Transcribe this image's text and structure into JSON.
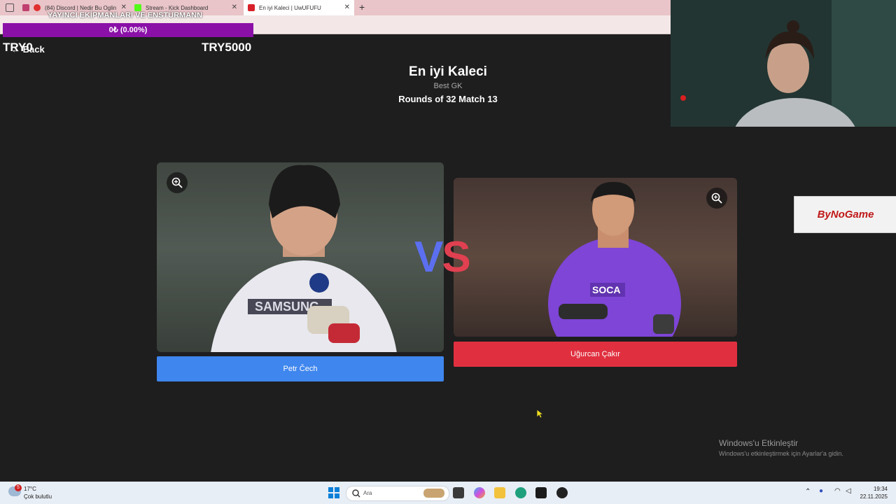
{
  "browser": {
    "tabs": [
      {
        "label": "(84) Discord | Nedir Bu Oglin"
      },
      {
        "label": "Stream - Kick Dashboard"
      },
      {
        "label": "En iyi Kaleci | UwUFUFU"
      }
    ],
    "new_tab": "+"
  },
  "overlay": {
    "donation_title": "YAYINCI EKİPMANLARI VE ENSTÜRMANN",
    "goal_progress": "0₺ (0.00%)",
    "goal_fraction": 0.0,
    "goal_min": "TRY0",
    "goal_max": "TRY5000"
  },
  "page": {
    "back_label": "Back",
    "title": "En iyi Kaleci",
    "subtitle": "Best GK",
    "round": "Rounds of 32 Match 13",
    "vs": "VS",
    "left_choice": "Petr Čech",
    "right_choice": "Uğurcan Çakır"
  },
  "sponsor": {
    "logo": "ByNoGame"
  },
  "watermark": {
    "title": "Windows'u Etkinleştir",
    "subtitle": "Windows'u etkinleştirmek için Ayarlar'a gidin."
  },
  "taskbar": {
    "weather_temp": "17°C",
    "weather_desc": "Çok bulutlu",
    "weather_badge": "5",
    "search_placeholder": "Ara",
    "time": "19:34",
    "date": "22.11.2025"
  },
  "colors": {
    "left_button": "#3f86ee",
    "right_button": "#e0303f",
    "goal_bar": "#8b10a8",
    "vs_left": "#5b6ff0",
    "vs_right": "#e04050"
  }
}
